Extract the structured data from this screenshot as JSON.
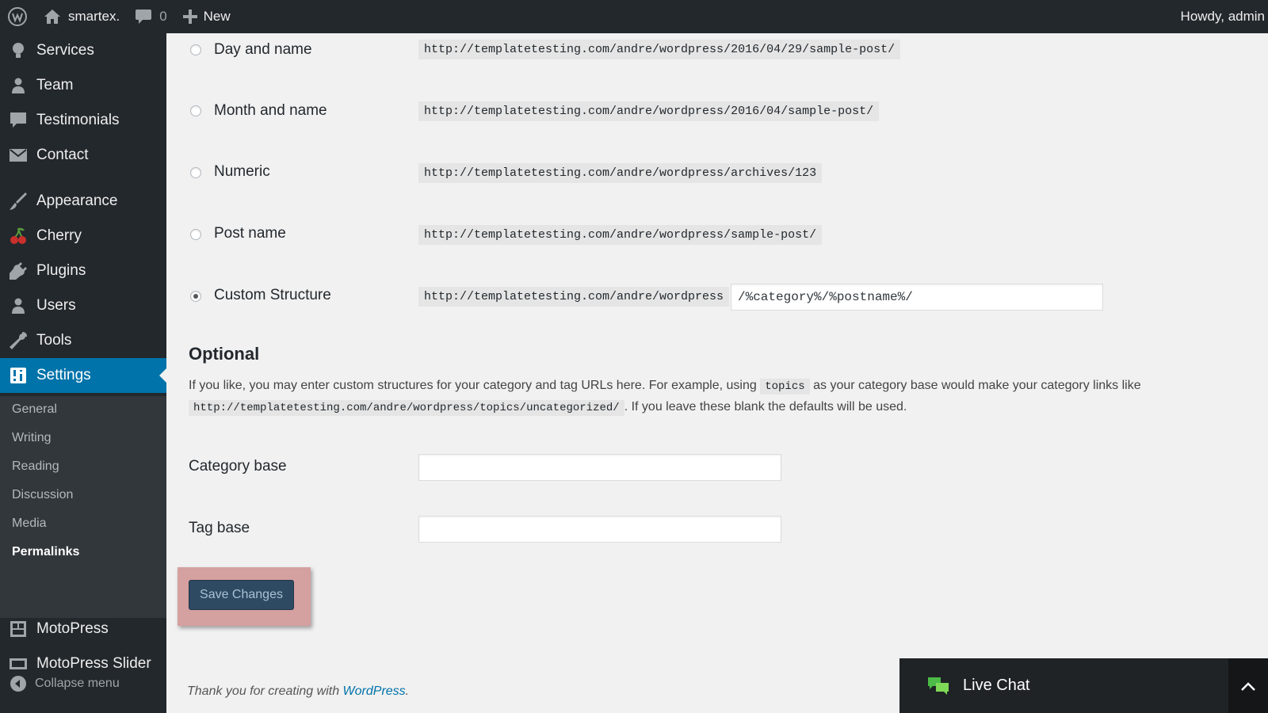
{
  "adminbar": {
    "wp_icon": "wordpress-logo-icon",
    "site_name": "smartex.",
    "comments_count": "0",
    "new_label": "New",
    "howdy": "Howdy, admin"
  },
  "sidebar": {
    "items": [
      {
        "label": "Services",
        "icon": "lightbulb-icon"
      },
      {
        "label": "Team",
        "icon": "person-icon"
      },
      {
        "label": "Testimonials",
        "icon": "quote-icon"
      },
      {
        "label": "Contact",
        "icon": "envelope-icon"
      },
      {
        "label": "Appearance",
        "icon": "paintbrush-icon"
      },
      {
        "label": "Cherry",
        "icon": "cherry-icon"
      },
      {
        "label": "Plugins",
        "icon": "plug-icon"
      },
      {
        "label": "Users",
        "icon": "users-icon"
      },
      {
        "label": "Tools",
        "icon": "wrench-icon"
      },
      {
        "label": "Settings",
        "icon": "settings-icon"
      },
      {
        "label": "MotoPress",
        "icon": "grid-icon"
      },
      {
        "label": "MotoPress Slider",
        "icon": "slider-icon"
      }
    ],
    "submenu": [
      "General",
      "Writing",
      "Reading",
      "Discussion",
      "Media",
      "Permalinks"
    ],
    "collapse_label": "Collapse menu"
  },
  "permalinks": {
    "options": [
      {
        "label": "Day and name",
        "example": "http://templatetesting.com/andre/wordpress/2016/04/29/sample-post/"
      },
      {
        "label": "Month and name",
        "example": "http://templatetesting.com/andre/wordpress/2016/04/sample-post/"
      },
      {
        "label": "Numeric",
        "example": "http://templatetesting.com/andre/wordpress/archives/123"
      },
      {
        "label": "Post name",
        "example": "http://templatetesting.com/andre/wordpress/sample-post/"
      },
      {
        "label": "Custom Structure",
        "example": "http://templatetesting.com/andre/wordpress",
        "value": "/%category%/%postname%/"
      }
    ],
    "selected": "Custom Structure"
  },
  "optional": {
    "heading": "Optional",
    "desc_part1": "If you like, you may enter custom structures for your category and tag URLs here. For example, using",
    "desc_code1": "topics",
    "desc_part2": "as your category base would make your category links like",
    "desc_code2": "http://templatetesting.com/andre/wordpress/topics/uncategorized/",
    "desc_part3": ". If you leave these blank the defaults will be used.",
    "category_base_label": "Category base",
    "category_base_value": "",
    "tag_base_label": "Tag base",
    "tag_base_value": ""
  },
  "save_label": "Save Changes",
  "footer": {
    "text": "Thank you for creating with",
    "link": "WordPress",
    "end": "."
  },
  "livechat": {
    "label": "Live Chat",
    "icon": "chat-bubbles-icon",
    "toggle_icon": "chevron-up-icon"
  }
}
